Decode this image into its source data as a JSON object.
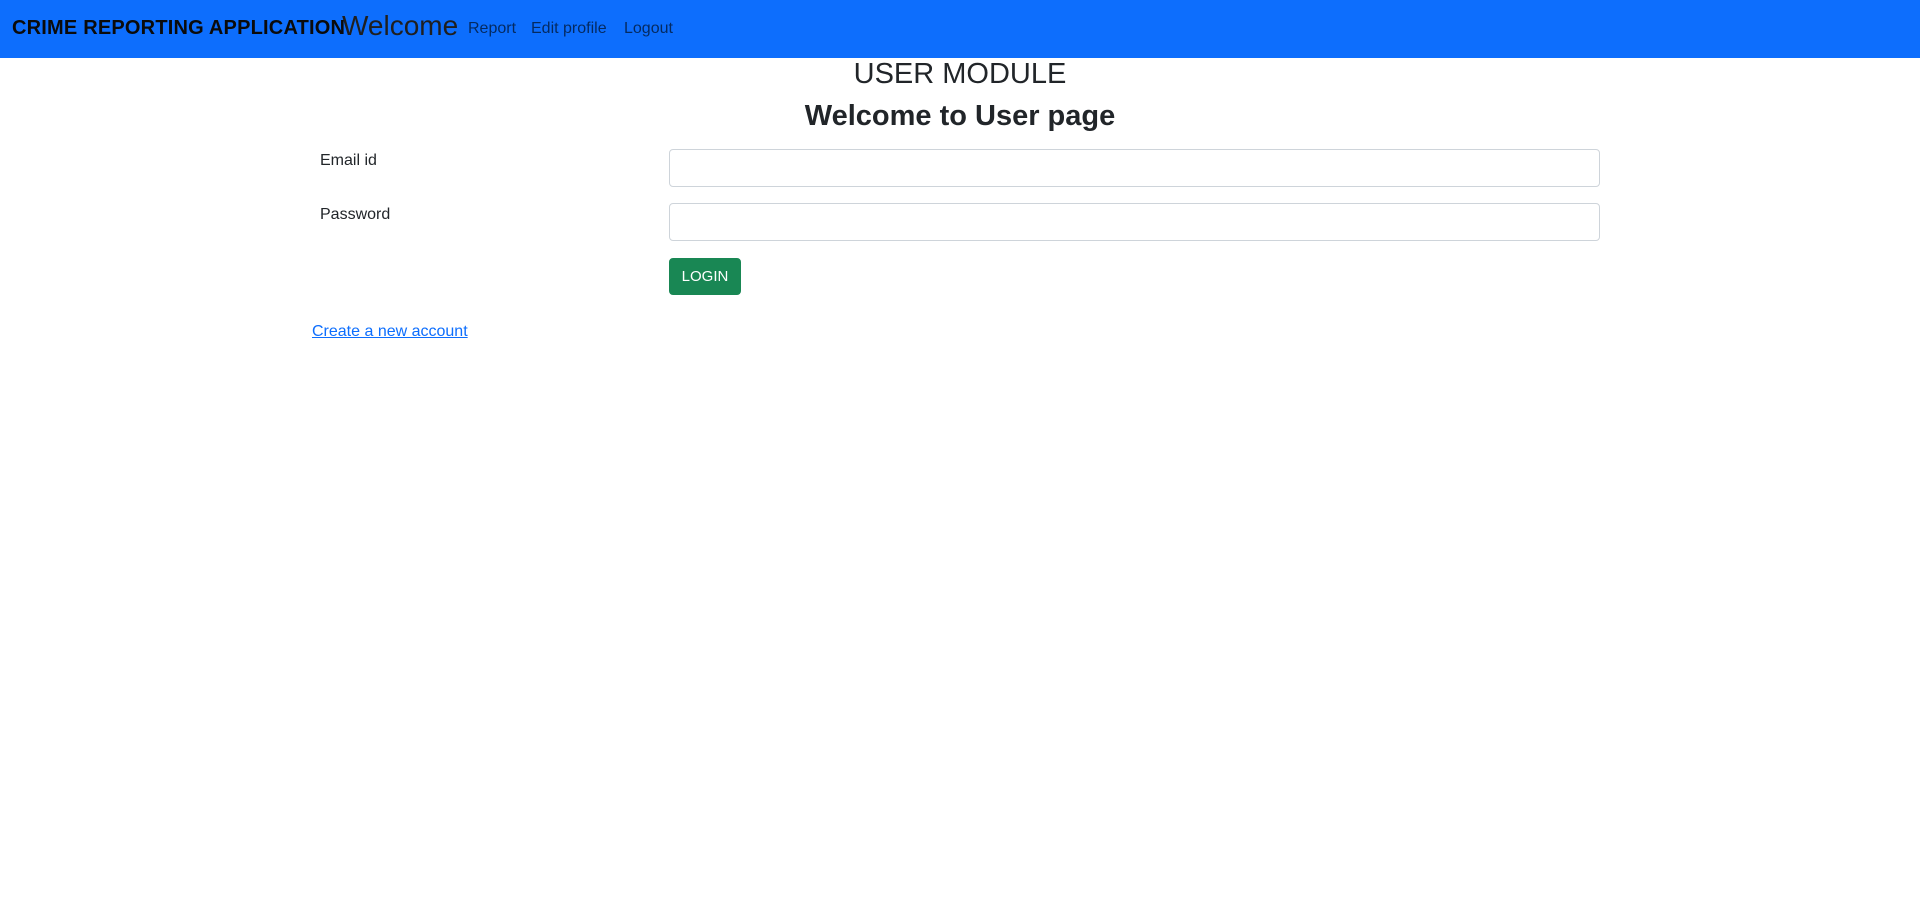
{
  "navbar": {
    "brand": "CRIME REPORTING APPLICATION",
    "welcome": "Welcome",
    "links": {
      "report": "Report",
      "edit_profile": "Edit profile",
      "logout": "Logout"
    }
  },
  "headings": {
    "module": "USER MODULE",
    "page": "Welcome to User page"
  },
  "form": {
    "email_label": "Email id",
    "email_value": "",
    "password_label": "Password",
    "password_value": "",
    "login_label": "LOGIN"
  },
  "footer_link": {
    "create_account": "Create a new account"
  },
  "colors": {
    "navbar_bg": "#0d6efd",
    "login_button": "#198754",
    "link": "#0d6efd"
  }
}
